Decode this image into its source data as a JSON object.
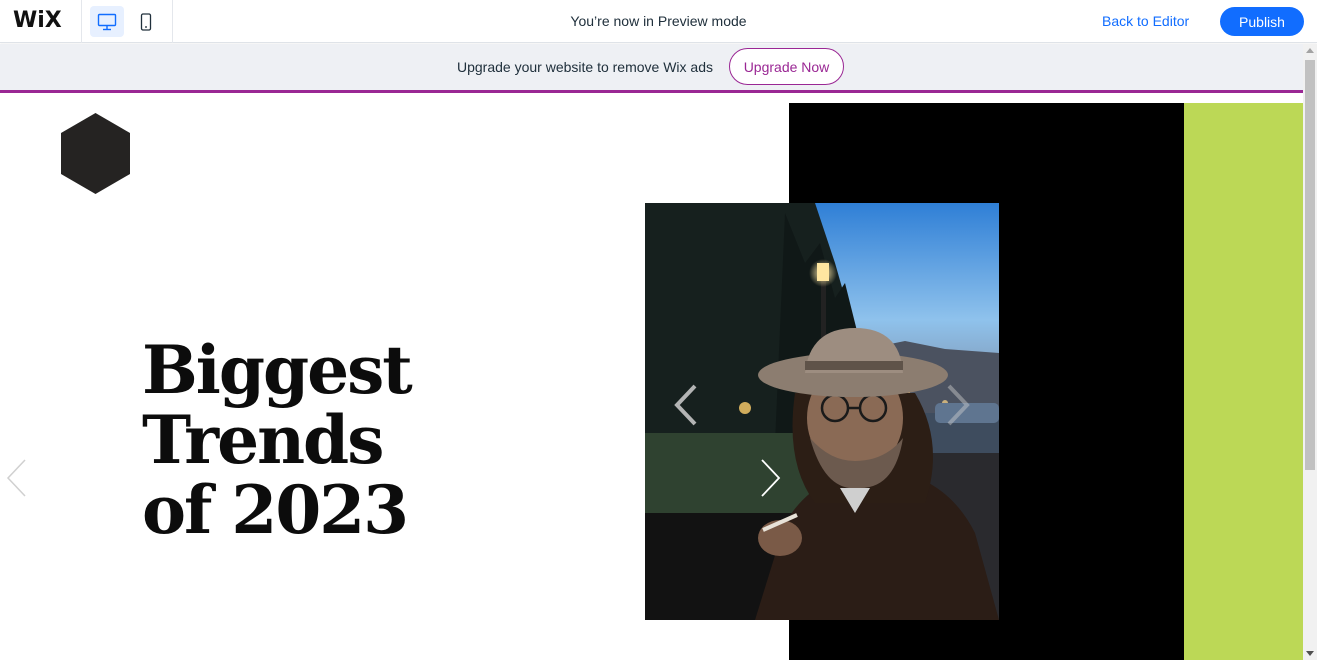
{
  "topbar": {
    "logo_text": "WiX",
    "desktop_icon": "desktop-monitor-icon",
    "mobile_icon": "mobile-phone-icon",
    "preview_text": "You’re now in Preview mode",
    "back_to_editor": "Back to Editor",
    "publish": "Publish",
    "accent_color": "#116dff"
  },
  "banner": {
    "text": "Upgrade your website to remove Wix ads",
    "button": "Upgrade Now",
    "accent_color": "#9a2794"
  },
  "site": {
    "logo_icon": "hexagon-logo-icon",
    "headline": [
      "Biggest",
      "Trends",
      "of 2023"
    ],
    "colors": {
      "black_panel": "#000000",
      "green_panel": "#bcd856"
    },
    "photo_icon": "portrait-photo-man-in-hat",
    "prev_icon": "chevron-left-icon",
    "next_icon": "chevron-right-icon"
  }
}
